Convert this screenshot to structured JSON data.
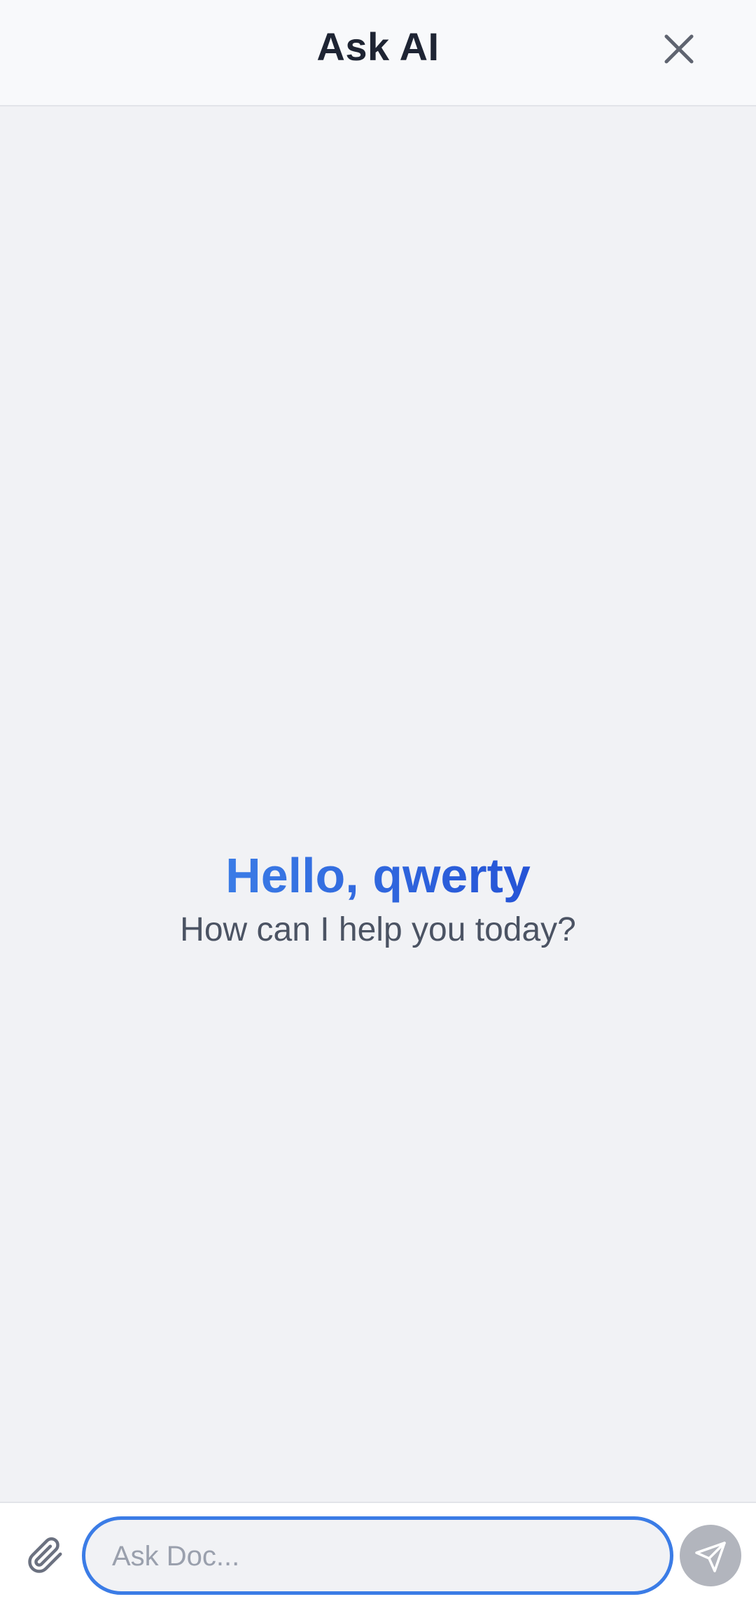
{
  "header": {
    "title": "Ask AI",
    "close_icon": "close-icon"
  },
  "greeting": {
    "title": "Hello, qwerty",
    "subtitle": "How can I help you today?"
  },
  "composer": {
    "attach_icon": "paperclip-icon",
    "placeholder": "Ask Doc...",
    "value": "",
    "send_icon": "send-icon"
  },
  "colors": {
    "accent": "#3b7ce6",
    "accent_dark": "#2553d6",
    "background": "#f1f2f5",
    "send_disabled": "#b2b5bd"
  }
}
